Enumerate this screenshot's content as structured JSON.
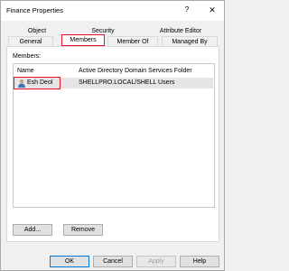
{
  "window": {
    "title": "Finance Properties",
    "help_glyph": "?",
    "close_glyph": "✕"
  },
  "tabs": {
    "row1": [
      "Object",
      "Security",
      "Attribute Editor"
    ],
    "row2": [
      "General",
      "Members",
      "Member Of",
      "Managed By"
    ],
    "active": "Members"
  },
  "members": {
    "label": "Members:",
    "columns": [
      "Name",
      "Active Directory Domain Services Folder"
    ],
    "rows": [
      {
        "name": "Esh Deol",
        "folder": "SHELLPRO.LOCAL/SHELL Users",
        "icon": "user-icon",
        "selected": true
      }
    ]
  },
  "actions": {
    "add": "Add...",
    "remove": "Remove"
  },
  "footer": {
    "ok": "OK",
    "cancel": "Cancel",
    "apply": "Apply",
    "help": "Help"
  },
  "colors": {
    "highlight": "#e81123",
    "selection": "#e5e5e5",
    "focus": "#0078d7"
  }
}
